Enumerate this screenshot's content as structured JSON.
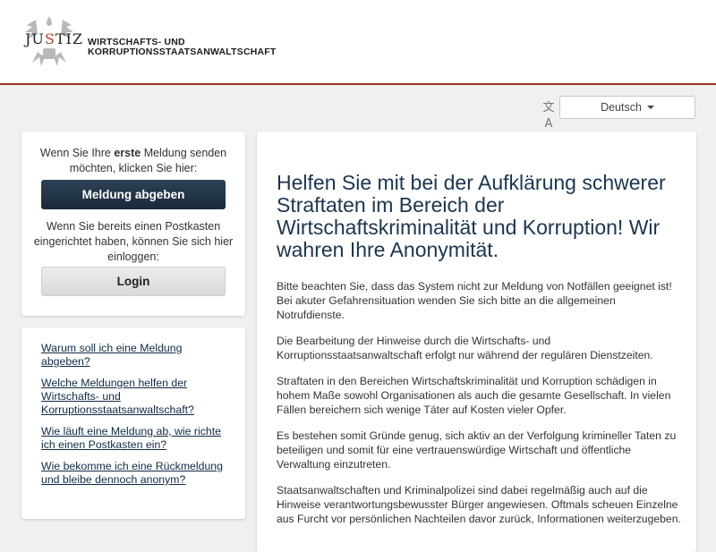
{
  "header": {
    "logo_text_parts": [
      "JU",
      "S",
      "TIZ"
    ],
    "org_line1": "WIRTSCHAFTS- UND",
    "org_line2": "KORRUPTIONSSTAATSANWALTSCHAFT"
  },
  "language": {
    "selected": "Deutsch"
  },
  "login_card": {
    "intro_prefix": "Wenn Sie Ihre ",
    "intro_bold": "erste",
    "intro_suffix": " Meldung senden möchten, klicken Sie hier:",
    "report_button": "Meldung abgeben",
    "existing_text": "Wenn Sie bereits einen Postkasten eingerichtet haben, können Sie sich hier einloggen:",
    "login_button": "Login"
  },
  "faq_links": [
    "Warum soll ich eine Meldung abgeben?",
    "Welche Meldungen helfen der Wirtschafts- und Korruptionsstaatsanwaltschaft?",
    "Wie läuft eine Meldung ab, wie richte ich einen Postkasten ein?",
    "Wie bekomme ich eine Rückmeldung und bleibe dennoch anonym?"
  ],
  "main": {
    "headline": "Helfen Sie mit bei der Aufklärung schwerer Straftaten im Bereich der Wirtschaftskriminalität und Korruption! Wir wahren Ihre Anonymität.",
    "paragraphs": [
      "Bitte beachten Sie, dass das System nicht zur Meldung von Notfällen geeignet ist! Bei akuter Gefahrensituation wenden Sie sich bitte an die allgemeinen Notrufdienste.",
      "Die Bearbeitung der Hinweise durch die Wirtschafts- und Korruptionsstaatsanwaltschaft erfolgt nur während der regulären Dienstzeiten.",
      "Straftaten in den Bereichen Wirtschaftskriminalität und Korruption schädigen in hohem Maße sowohl Organisationen als auch die gesamte Gesellschaft. In vielen Fällen bereichern sich wenige Täter auf Kosten vieler Opfer.",
      "Es bestehen somit Gründe genug, sich aktiv an der Verfolgung krimineller Taten zu beteiligen und somit für eine vertrauenswürdige Wirtschaft und öffentliche Verwaltung einzutreten.",
      "Staatsanwaltschaften und Kriminalpolizei sind dabei regelmäßig auch auf die Hinweise verantwortungsbewusster Bürger angewiesen. Oftmals scheuen Einzelne aus Furcht vor persönlichen Nachteilen davor zurück, Informationen weiterzugeben."
    ]
  },
  "colors": {
    "accent_red": "#9b2d20",
    "primary_button": "#1f3347",
    "link": "#0f2a46",
    "headline": "#1b3550"
  }
}
